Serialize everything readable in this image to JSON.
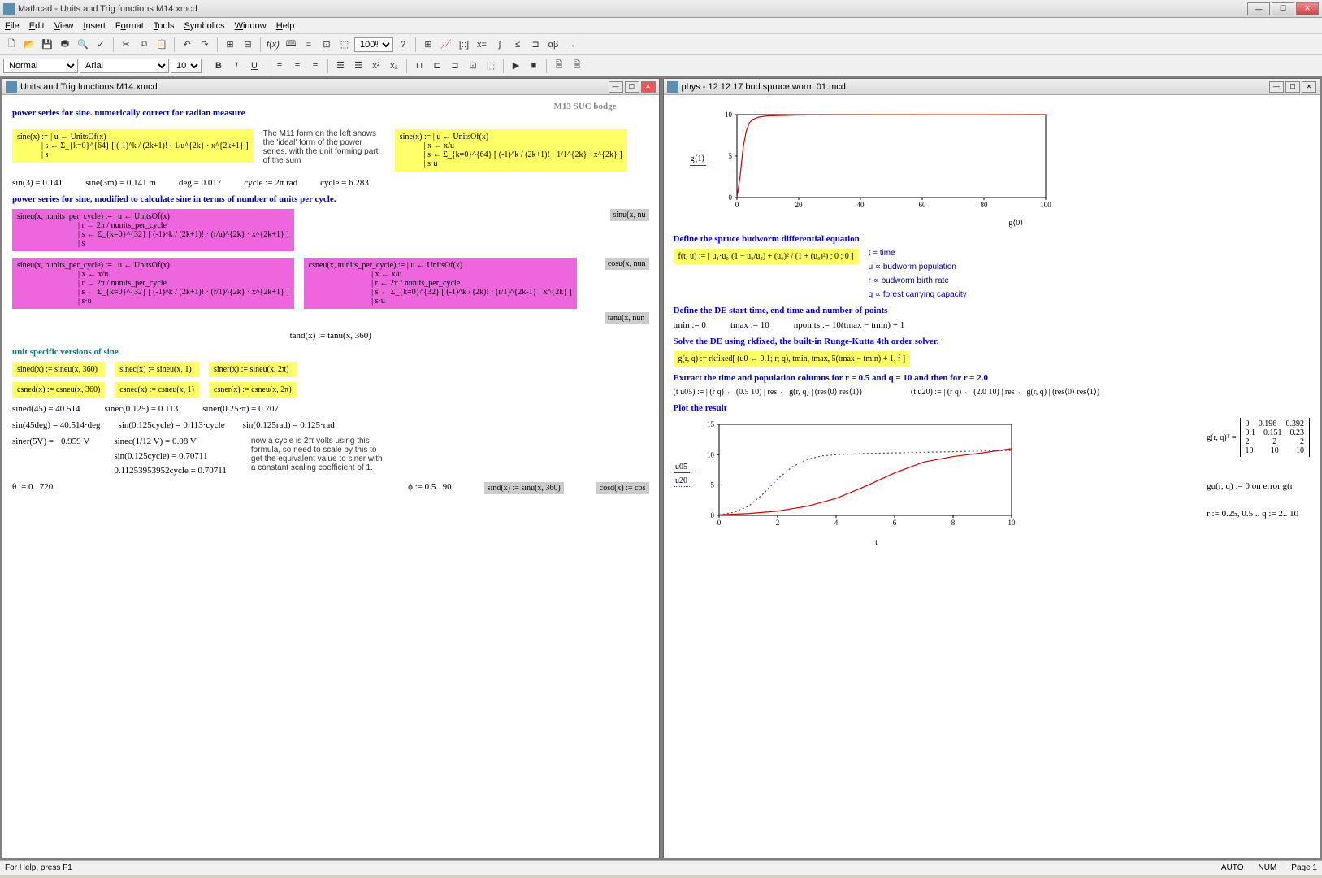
{
  "app": {
    "title": "Mathcad - Units and Trig functions M14.xmcd",
    "menus": [
      "File",
      "Edit",
      "View",
      "Insert",
      "Format",
      "Tools",
      "Symbolics",
      "Window",
      "Help"
    ],
    "style_select": "Normal",
    "font_select": "Arial",
    "size_select": "10",
    "zoom_select": "100%",
    "status_left": "For Help, press F1",
    "status_auto": "AUTO",
    "status_num": "NUM",
    "status_page": "Page 1"
  },
  "doc1": {
    "title": "Units and Trig functions M14.xmcd",
    "h1": "power series for sine.   numerically correct for radian measure",
    "h1r": "M13 SUC bodge",
    "sine_def_left": "sine(x) := | u ← UnitsOf(x)\n            | s ← Σ_{k=0}^{64} [ (-1)^k / (2k+1)! · 1/u^{2k} · x^{2k+1} ]\n            | s",
    "sine_note": "The M11 form on the left shows the 'ideal' form of the power series, with the unit forming part of the sum",
    "sine_def_right": "sine(x) := | u ← UnitsOf(x)\n            | x ← x/u\n            | s ← Σ_{k=0}^{64} [ (-1)^k / (2k+1)! · 1/1^{2k} · x^{2k} ]\n            | s·u",
    "results1": [
      "sin(3) = 0.141",
      "sine(3m) = 0.141 m",
      "deg = 0.017",
      "cycle := 2π rad",
      "cycle = 6.283"
    ],
    "h2": "power series for sine, modified to calculate sine in terms of number of units per cycle.",
    "sineu_def1": "sineu(x, nunits_per_cycle) := | u ← UnitsOf(x)\n                              | r ← 2π / nunits_per_cycle\n                              | s ← Σ_{k=0}^{32} [ (-1)^k / (2k+1)! · (r/u)^{2k} · x^{2k+1} ]\n                              | s",
    "sinu_grey": "sinu(x, nu",
    "sineu_def2": "sineu(x, nunits_per_cycle) := | u ← UnitsOf(x)\n                              | x ← x/u\n                              | r ← 2π / nunits_per_cycle\n                              | s ← Σ_{k=0}^{32} [ (-1)^k / (2k+1)! · (r/1)^{2k} · x^{2k+1} ]\n                              | s·u",
    "csneu_def": "csneu(x, nunits_per_cycle) := | u ← UnitsOf(x)\n                               | x ← x/u\n                               | r ← 2π / nunits_per_cycle\n                               | s ← Σ_{k=0}^{32} [ (-1)^k / (2k)! · (r/1)^{2k-1} · x^{2k} ]\n                               | s·u",
    "cosu_grey": "cosu(x, nun",
    "tanu_grey": "tanu(x, nun",
    "tand_def": "tand(x) := tanu(x, 360)",
    "h3": "unit specific versions of sine",
    "defs": {
      "sined": "sined(x) := sineu(x, 360)",
      "csned": "csned(x) := csneu(x, 360)",
      "sinec": "sinec(x) := sineu(x, 1)",
      "csnec": "csnec(x) := csneu(x, 1)",
      "siner": "siner(x) := sineu(x, 2π)",
      "csner": "csner(x) := csneu(x, 2π)"
    },
    "results2": {
      "a": "sined(45) = 40.514",
      "b": "sinec(0.125) = 0.113",
      "c": "siner(0.25·π) = 0.707",
      "d": "sin(45deg) = 40.514·deg",
      "e": "sin(0.125cycle) = 0.113·cycle",
      "f": "sin(0.125rad) = 0.125·rad",
      "g": "siner(5V) = −0.959 V",
      "h": "sinec(1/12 V) = 0.08 V",
      "i": "sin(0.125cycle) = 0.70711",
      "j": "0.11253953952cycle = 0.70711"
    },
    "note2": "now a cycle is 2π volts using this formula, so need to scale by this to get the equivalent value to siner with a constant scaling coefficient of 1.",
    "ranges": {
      "theta": "θ := 0.. 720",
      "phi": "ϕ := 0.5.. 90",
      "sind": "sind(x) := sinu(x, 360)",
      "cosd": "cosd(x) := cos"
    }
  },
  "doc2": {
    "title": "phys - 12 12 17 bud spruce worm 01.mcd",
    "h1": "Define the spruce budworm differential equation",
    "ftu": "f(t, u) := [ u₁·u₀·(1 − u₀/u₂) + (u₀)² / (1 + (u₀)²) ; 0 ; 0 ]",
    "vars": [
      "t = time",
      "u ∝ budworm population",
      "r ∝ budworm birth rate",
      "q ∝ forest carrying capacity"
    ],
    "h2": "Define the DE start time, end time and number of points",
    "times": [
      "tmin := 0",
      "tmax := 10",
      "npoints := 10(tmax − tmin) + 1"
    ],
    "h3": "Solve the DE using rkfixed, the built-in Runge-Kutta 4th order solver.",
    "grq": "g(r, q) := rkfixed[ (u0 ← 0.1; r; q), tmin, tmax, 5(tmax − tmin) + 1, f ]",
    "h4": "Extract the time and population columns for r = 0.5 and q = 10 and then for r = 2.0",
    "tu05": "(t  u05) := | (r  q) ← (0.5  10)\n             | res ← g(r, q)\n             | (res⟨0⟩  res⟨1⟩)",
    "tu20": "(t  u20) := | (r  q) ← (2.0  10)\n             | res ← g(r, q)\n             | (res⟨0⟩  res⟨1⟩)",
    "h5": "Plot the result",
    "grq_mat_label": "g(r, q)ᵀ =",
    "grq_mat": [
      [
        "0",
        "0.196",
        "0.392"
      ],
      [
        "0.1",
        "0.151",
        "0.23"
      ],
      [
        "2",
        "2",
        "2"
      ],
      [
        "10",
        "10",
        "10"
      ]
    ],
    "gu": "gu(r, q) := 0  on error g(r",
    "rrange": "r := 0.25, 0.5 .. q := 2.. 10"
  },
  "chart_data": [
    {
      "type": "line",
      "title": "",
      "xlabel": "g⟨0⟩",
      "ylabel": "g⟨1⟩",
      "xlim": [
        0,
        100
      ],
      "ylim": [
        0,
        10
      ],
      "xticks": [
        0,
        20,
        40,
        60,
        80,
        100
      ],
      "yticks": [
        0,
        5,
        10
      ],
      "series": [
        {
          "name": "g⟨1⟩",
          "color": "#d00",
          "x": [
            0,
            1,
            2,
            3,
            4,
            5,
            7,
            10,
            15,
            20,
            30,
            40,
            60,
            80,
            100
          ],
          "y": [
            0,
            2.5,
            6,
            8,
            9,
            9.4,
            9.7,
            9.85,
            9.9,
            9.95,
            9.97,
            9.98,
            9.99,
            9.99,
            10
          ]
        }
      ]
    },
    {
      "type": "line",
      "title": "",
      "xlabel": "t",
      "ylabel": "",
      "xlim": [
        0,
        10
      ],
      "ylim": [
        0,
        15
      ],
      "xticks": [
        0,
        2,
        4,
        6,
        8,
        10
      ],
      "yticks": [
        0,
        5,
        10,
        15
      ],
      "legend": [
        "u05",
        "u20"
      ],
      "series": [
        {
          "name": "u05",
          "color": "#d00",
          "style": "solid",
          "x": [
            0,
            1,
            2,
            3,
            4,
            5,
            6,
            7,
            8,
            9,
            10
          ],
          "y": [
            0.1,
            0.3,
            0.7,
            1.5,
            2.8,
            4.8,
            7,
            8.8,
            9.7,
            10.3,
            11
          ]
        },
        {
          "name": "u20",
          "color": "#44a",
          "style": "dotted",
          "x": [
            0,
            0.5,
            1,
            1.5,
            2,
            2.5,
            3,
            3.5,
            4,
            5,
            6,
            7,
            8,
            9,
            10
          ],
          "y": [
            0.1,
            0.5,
            1.5,
            3.5,
            6,
            8,
            9.2,
            9.8,
            10,
            10.2,
            10.3,
            10.4,
            10.5,
            10.6,
            10.7
          ]
        }
      ]
    }
  ]
}
